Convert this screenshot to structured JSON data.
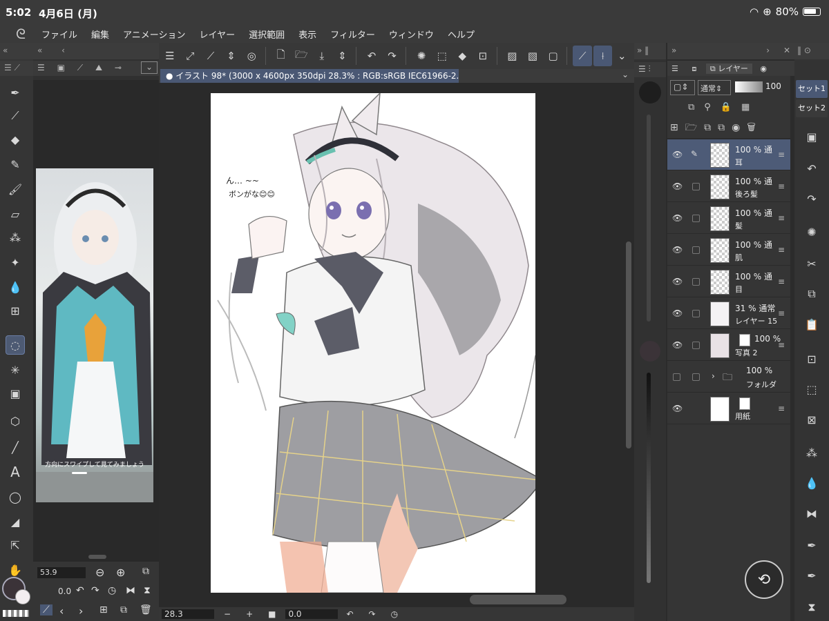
{
  "status": {
    "time": "5:02",
    "date": "4月6日 (月)",
    "battery": "80%"
  },
  "menu": [
    "ファイル",
    "編集",
    "アニメーション",
    "レイヤー",
    "選択範囲",
    "表示",
    "フィルター",
    "ウィンドウ",
    "ヘルプ"
  ],
  "document": {
    "title": "イラスト 98* (3000 x 4600px 350dpi 28.3% : RGB:sRGB IEC61966-2.1)"
  },
  "brush": {
    "size": "53.9",
    "angle": "0.0"
  },
  "reference": {
    "caption": "方向にスワイプして見てみましょう"
  },
  "layer_panel": {
    "tab_label": "レイヤー",
    "blend_mode": "通常",
    "opacity": "100",
    "layers": [
      {
        "opacity": "100 %",
        "blend": "通",
        "name": "耳",
        "selected": true
      },
      {
        "opacity": "100 %",
        "blend": "通",
        "name": "後ろ髪"
      },
      {
        "opacity": "100 %",
        "blend": "通",
        "name": "髪"
      },
      {
        "opacity": "100 %",
        "blend": "通",
        "name": "肌"
      },
      {
        "opacity": "100 %",
        "blend": "通",
        "name": "目"
      },
      {
        "opacity": "31 %",
        "blend": "通常",
        "name": "レイヤー 15"
      },
      {
        "opacity": "100 %",
        "blend": "",
        "name": "写真 2"
      },
      {
        "opacity": "100 %",
        "blend": "",
        "name": "フォルダ"
      },
      {
        "opacity": "",
        "blend": "",
        "name": "用紙"
      }
    ]
  },
  "sets": [
    "セット1",
    "セット2"
  ],
  "canvas_note": {
    "line1": "ん… ~~",
    "line2": "ボンがな😊😊"
  },
  "footer": {
    "zoom": "28.3",
    "rotation": "0.0"
  },
  "colors": {
    "accent": "#4a5874",
    "panel": "#333333",
    "main_color": "#3b3338"
  }
}
